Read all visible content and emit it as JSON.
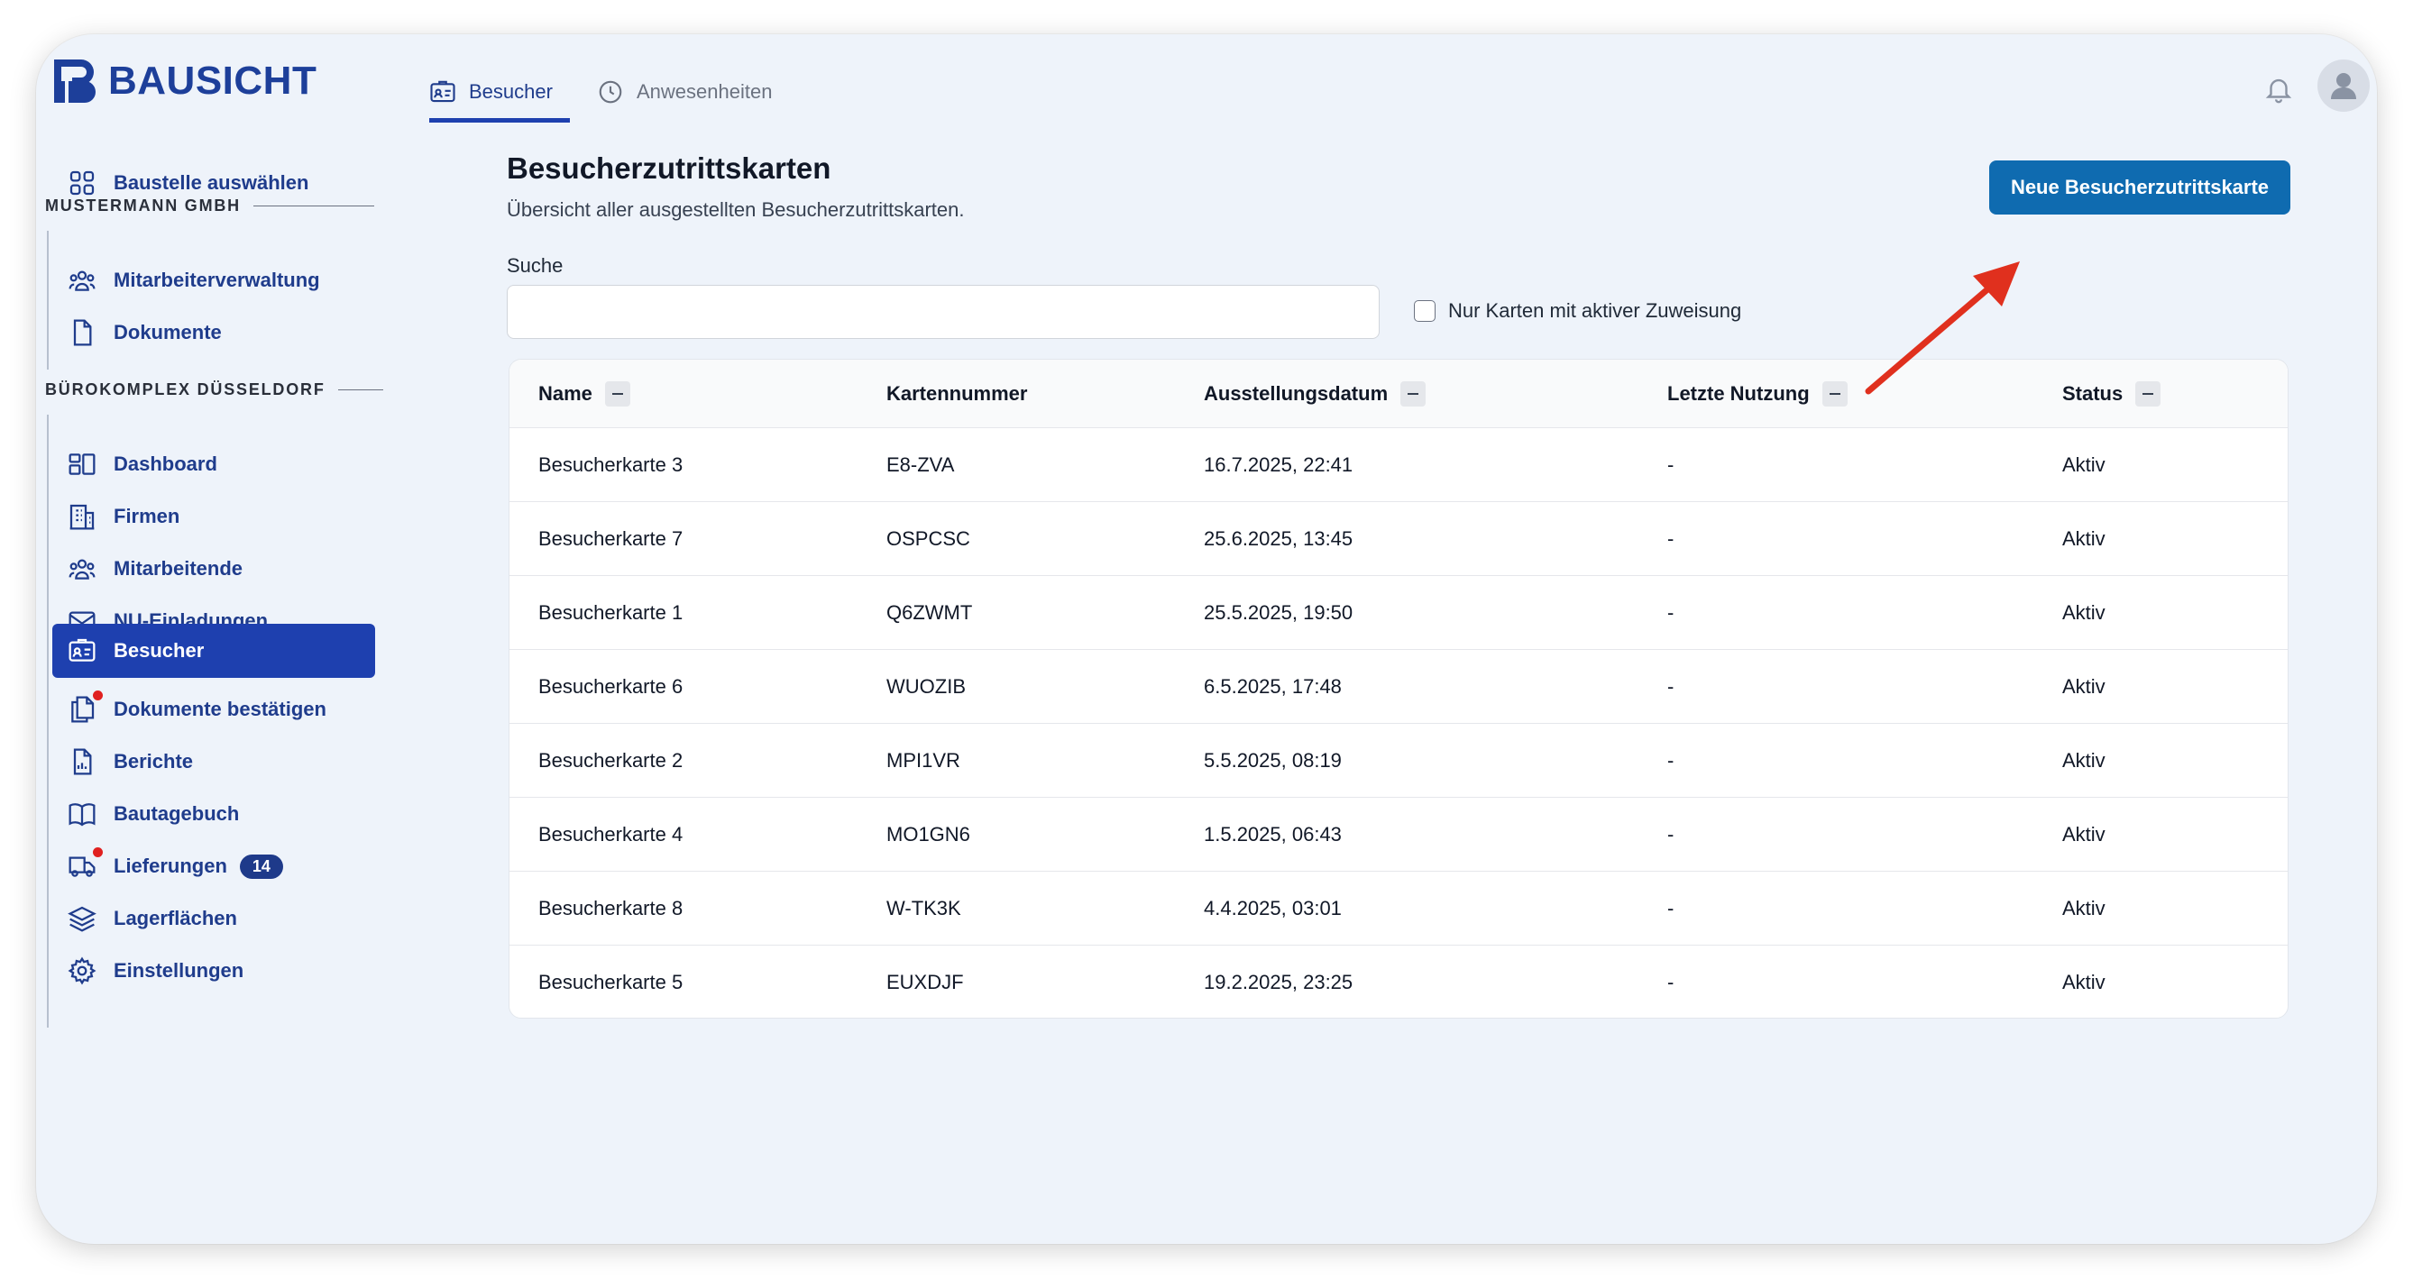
{
  "app": {
    "logo_text": "BAUSICHT"
  },
  "sidebar": {
    "select_site": "Baustelle auswählen",
    "company_group": {
      "label": "MUSTERMANN GMBH",
      "items": [
        {
          "label": "Mitarbeiterverwaltung",
          "icon": "users-icon"
        },
        {
          "label": "Dokumente",
          "icon": "document-icon"
        }
      ]
    },
    "site_group": {
      "label": "BÜROKOMPLEX DÜSSELDORF",
      "items": [
        {
          "label": "Dashboard",
          "icon": "dashboard-icon"
        },
        {
          "label": "Firmen",
          "icon": "building-icon"
        },
        {
          "label": "Mitarbeitende",
          "icon": "users-icon"
        },
        {
          "label": "NU-Einladungen",
          "icon": "envelope-icon"
        },
        {
          "label": "Besucher",
          "icon": "id-card-icon",
          "active": true
        },
        {
          "label": "Dokumente bestätigen",
          "icon": "documents-icon",
          "notification": true
        },
        {
          "label": "Berichte",
          "icon": "report-icon"
        },
        {
          "label": "Bautagebuch",
          "icon": "book-icon"
        },
        {
          "label": "Lieferungen",
          "icon": "truck-icon",
          "notification": true,
          "badge": "14"
        },
        {
          "label": "Lagerflächen",
          "icon": "layers-icon"
        },
        {
          "label": "Einstellungen",
          "icon": "gear-icon"
        }
      ]
    }
  },
  "tabs": [
    {
      "label": "Besucher",
      "icon": "id-card-icon",
      "active": true
    },
    {
      "label": "Anwesenheiten",
      "icon": "clock-icon",
      "active": false
    }
  ],
  "header_icons": [
    "bell-icon",
    "user-avatar-icon"
  ],
  "main": {
    "title": "Besucherzutrittskarten",
    "subtitle": "Übersicht aller ausgestellten Besucherzutrittskarten.",
    "new_button": "Neue Besucherzutrittskarte",
    "search_label": "Suche",
    "search_value": "",
    "filter_checkbox": {
      "label": "Nur Karten mit aktiver Zuweisung",
      "checked": false
    },
    "table": {
      "columns": [
        "Name",
        "Kartennummer",
        "Ausstellungsdatum",
        "Letzte Nutzung",
        "Status"
      ],
      "rows": [
        [
          "Besucherkarte 3",
          "E8-ZVA",
          "16.7.2025, 22:41",
          "-",
          "Aktiv"
        ],
        [
          "Besucherkarte 7",
          "OSPCSC",
          "25.6.2025, 13:45",
          "-",
          "Aktiv"
        ],
        [
          "Besucherkarte 1",
          "Q6ZWMT",
          "25.5.2025, 19:50",
          "-",
          "Aktiv"
        ],
        [
          "Besucherkarte 6",
          "WUOZIB",
          "6.5.2025, 17:48",
          "-",
          "Aktiv"
        ],
        [
          "Besucherkarte 2",
          "MPI1VR",
          "5.5.2025, 08:19",
          "-",
          "Aktiv"
        ],
        [
          "Besucherkarte 4",
          "MO1GN6",
          "1.5.2025, 06:43",
          "-",
          "Aktiv"
        ],
        [
          "Besucherkarte 8",
          "W-TK3K",
          "4.4.2025, 03:01",
          "-",
          "Aktiv"
        ],
        [
          "Besucherkarte 5",
          "EUXDJF",
          "19.2.2025, 23:25",
          "-",
          "Aktiv"
        ]
      ]
    }
  },
  "annotation": {
    "color": "#e0301e"
  },
  "colors": {
    "primary": "#1e40af",
    "button": "#0f6bb0",
    "notification": "#e02020"
  }
}
